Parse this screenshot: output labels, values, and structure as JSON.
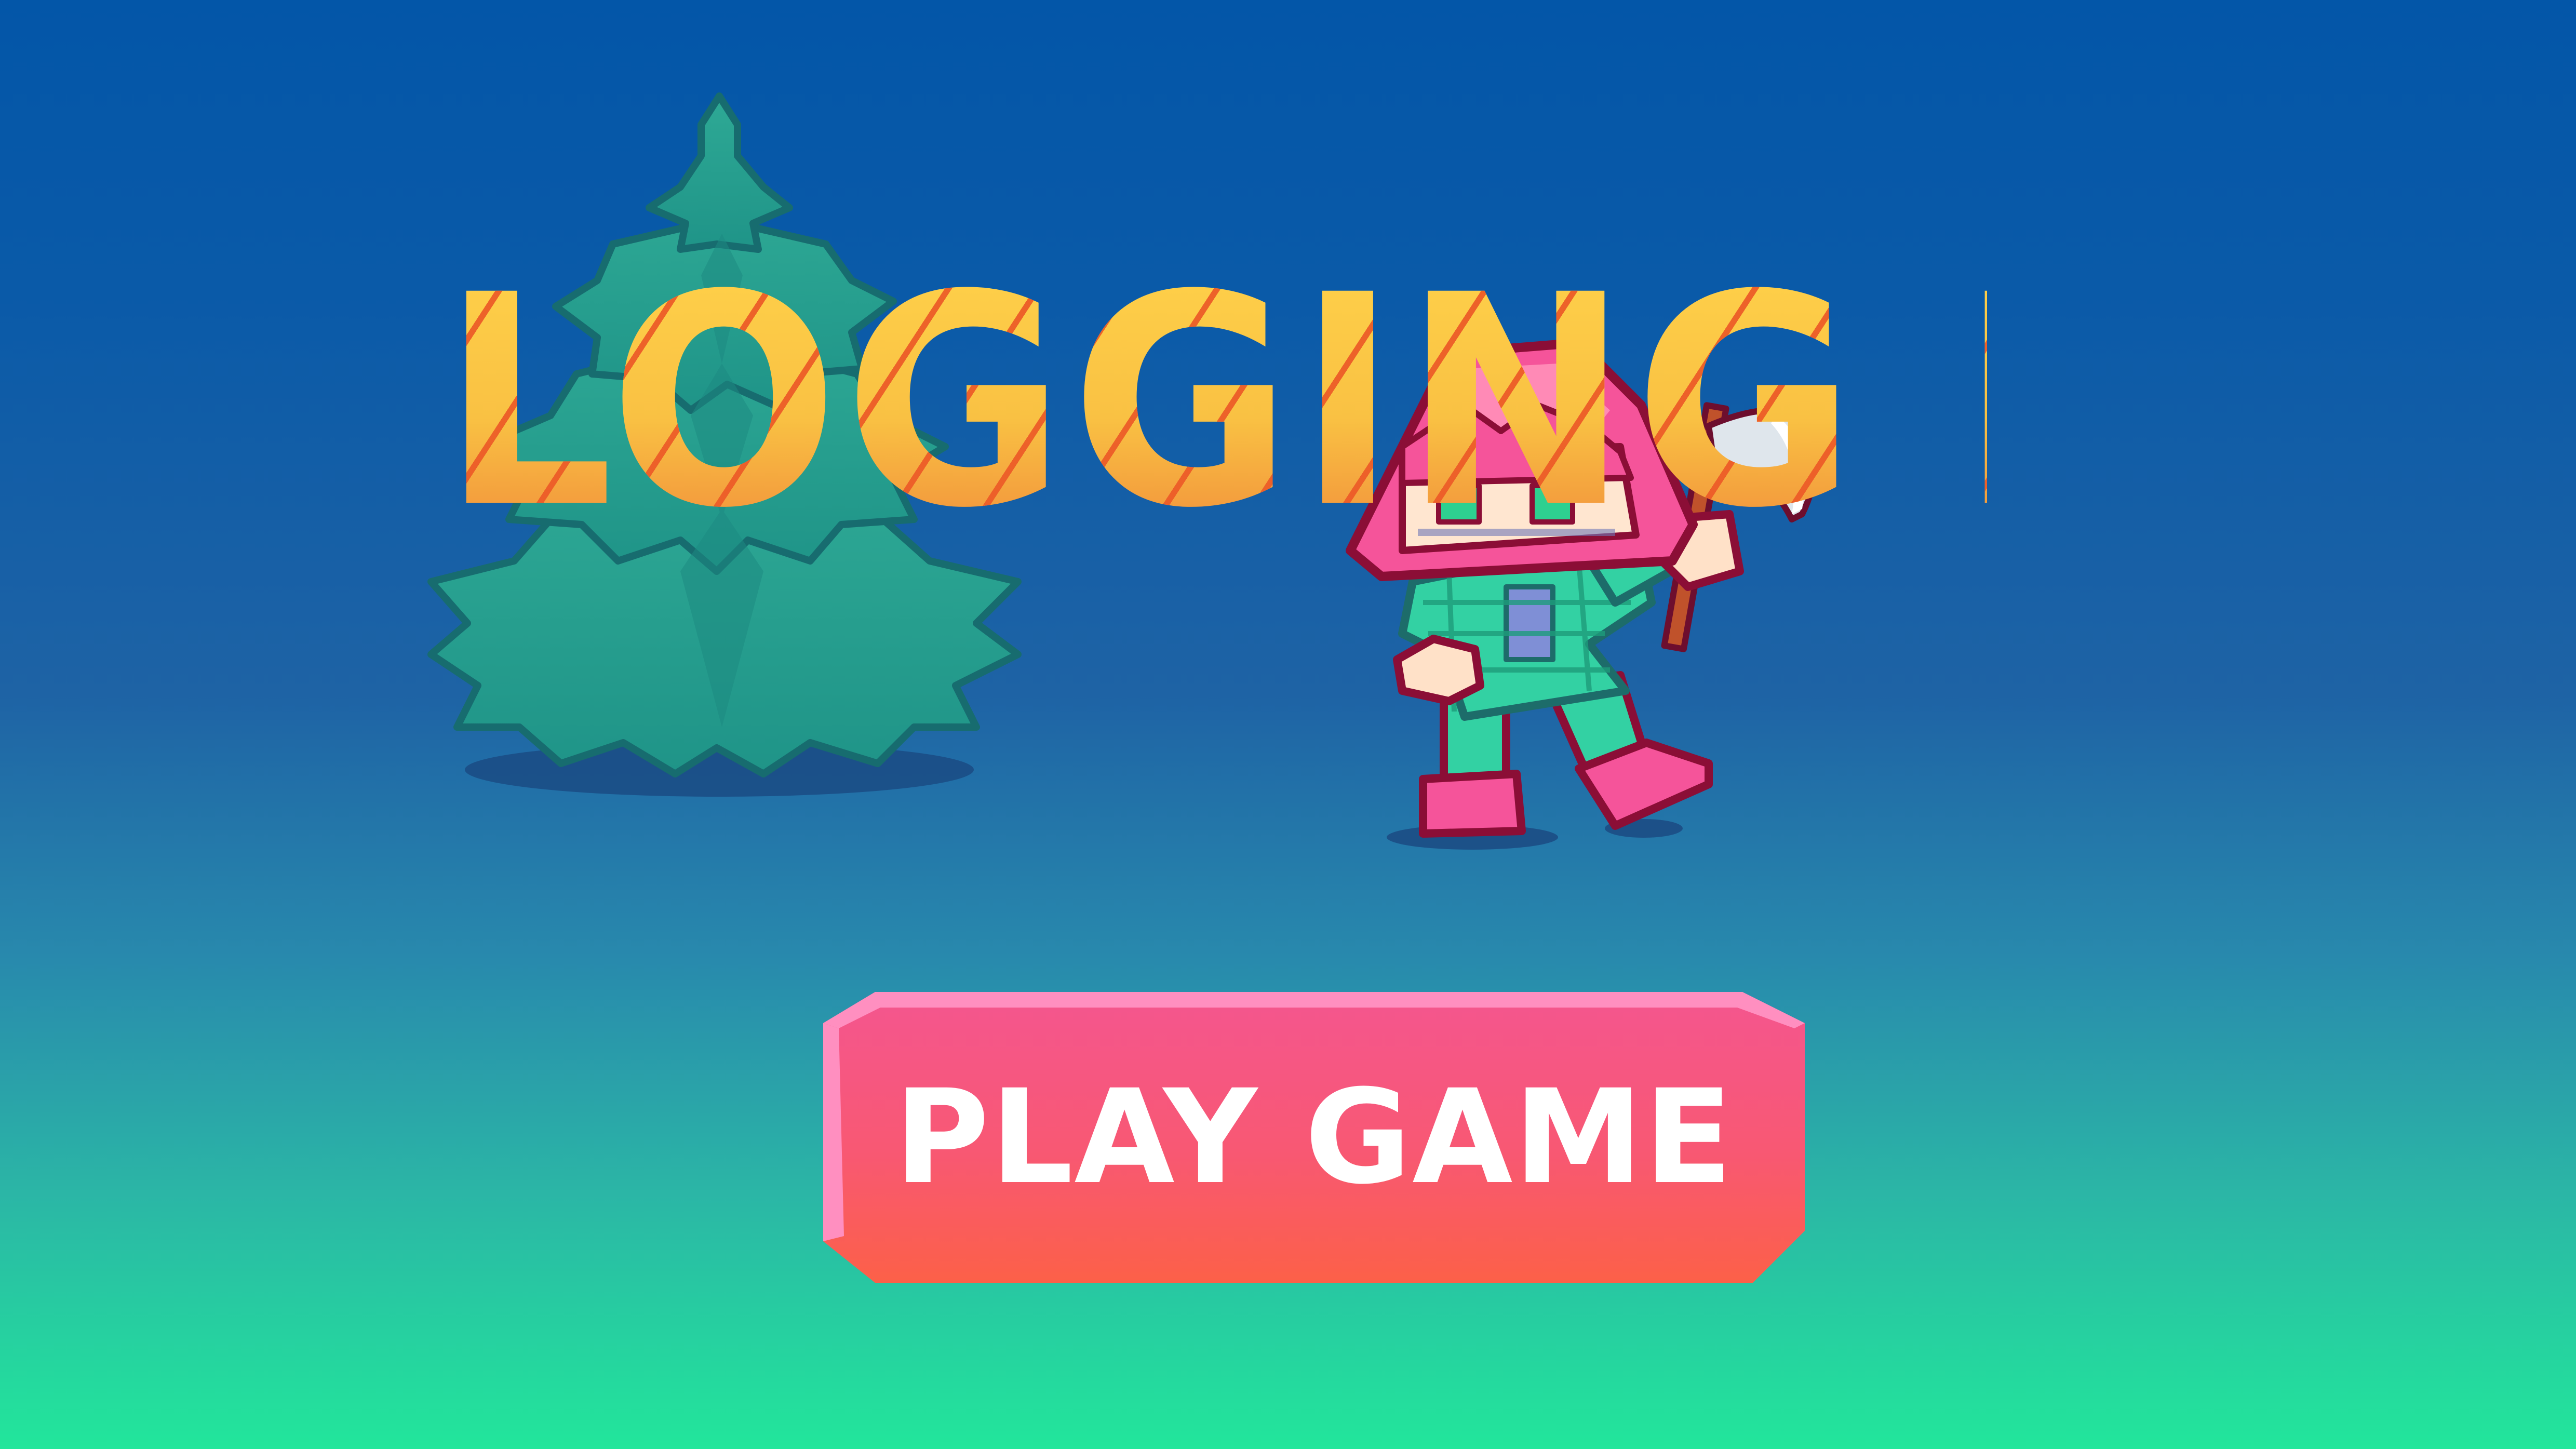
{
  "game": {
    "title": "LOGGING IN",
    "play_button_label": "PLAY GAME"
  },
  "sprites": {
    "tree": "pine-tree",
    "character": "lumberjack-girl-with-axe"
  },
  "colors": {
    "background_top": "#0356a8",
    "background_bottom": "#22e69b",
    "title_fill_top": "#ffd24a",
    "title_fill_bottom": "#f0883a",
    "title_grain": "#ec5c28",
    "button_top": "#f4568f",
    "button_bottom": "#fc6048",
    "button_highlight": "#ff8fc0",
    "tree_green": "#27a592",
    "character_hair": "#f5549a",
    "character_shirt": "#33d1a3",
    "outline": "#8b0e36"
  }
}
